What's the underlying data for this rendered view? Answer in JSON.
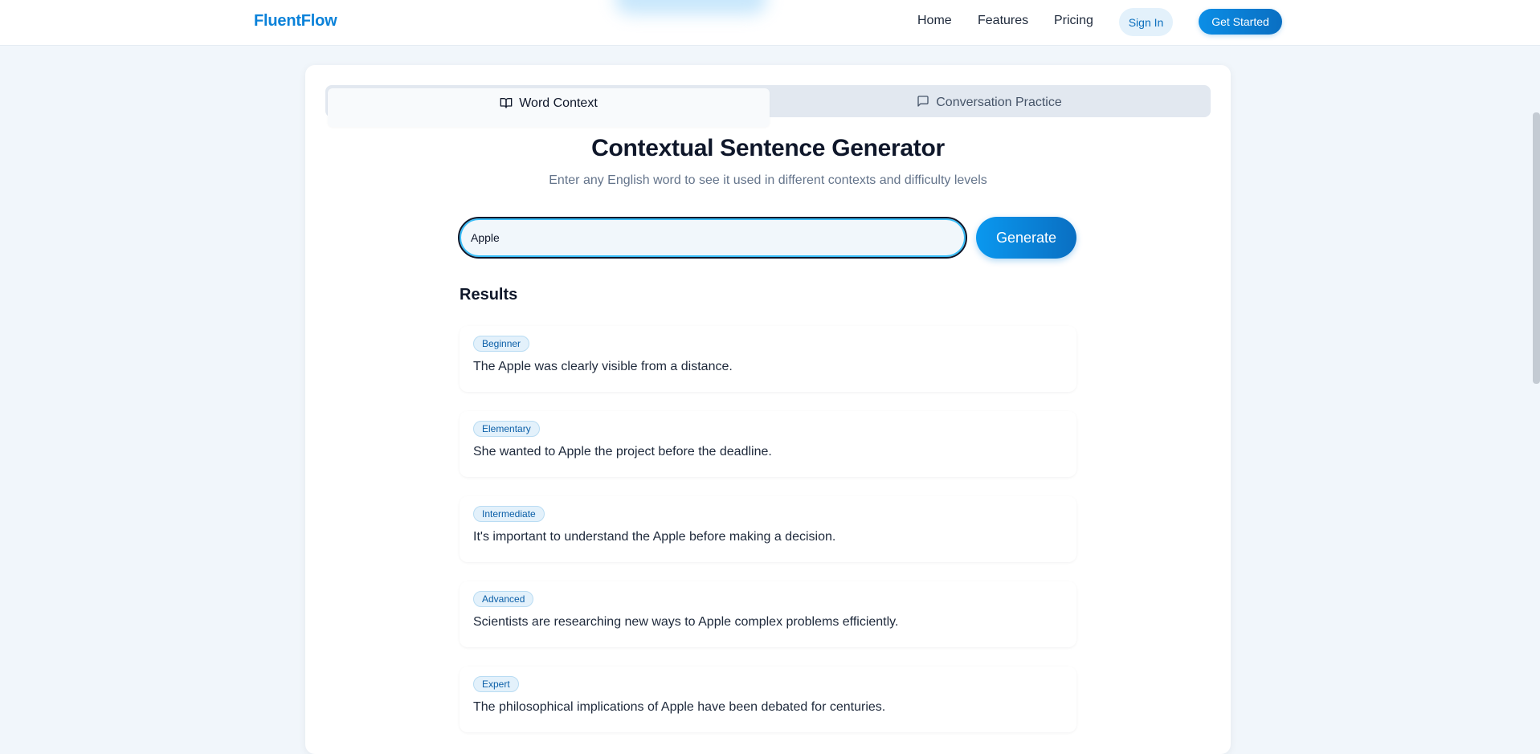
{
  "nav": {
    "brand": "FluentFlow",
    "links": [
      "Home",
      "Features",
      "Pricing"
    ],
    "sign_in": "Sign In",
    "get_started": "Get Started"
  },
  "tabs": [
    {
      "label": "Word Context",
      "icon": "book-open-icon",
      "active": true
    },
    {
      "label": "Conversation Practice",
      "icon": "message-square-icon",
      "active": false
    }
  ],
  "main": {
    "title": "Contextual Sentence Generator",
    "subtitle": "Enter any English word to see it used in different contexts and difficulty levels",
    "input_value": "Apple",
    "generate_label": "Generate",
    "results_heading": "Results"
  },
  "results": [
    {
      "level": "Beginner",
      "sentence": "The Apple was clearly visible from a distance."
    },
    {
      "level": "Elementary",
      "sentence": "She wanted to Apple the project before the deadline."
    },
    {
      "level": "Intermediate",
      "sentence": "It's important to understand the Apple before making a decision."
    },
    {
      "level": "Advanced",
      "sentence": "Scientists are researching new ways to Apple complex problems efficiently."
    },
    {
      "level": "Expert",
      "sentence": "The philosophical implications of Apple have been debated for centuries."
    }
  ],
  "colors": {
    "brand": "#0b82d9",
    "accent": "#0a8ee6",
    "background": "#f1f6fb"
  }
}
